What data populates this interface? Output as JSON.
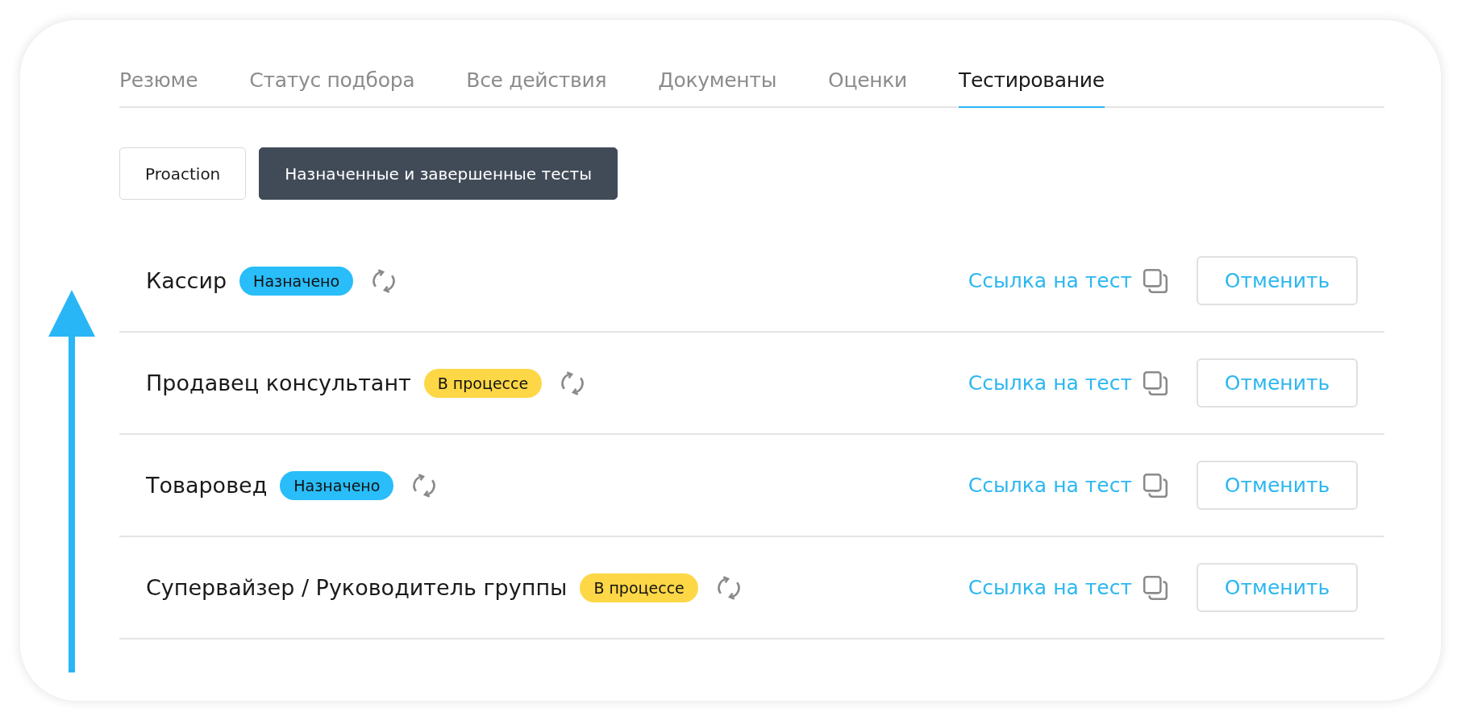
{
  "tabs": [
    {
      "label": "Резюме",
      "selected": false
    },
    {
      "label": "Статус подбора",
      "selected": false
    },
    {
      "label": "Все действия",
      "selected": false
    },
    {
      "label": "Документы",
      "selected": false
    },
    {
      "label": "Оценки",
      "selected": false
    },
    {
      "label": "Тестирование",
      "selected": true
    }
  ],
  "subtabs": [
    {
      "label": "Proaction",
      "selected": false
    },
    {
      "label": "Назначенные и завершенные тесты",
      "selected": true
    }
  ],
  "tests": [
    {
      "name": "Кассир",
      "status": {
        "label": "Назначено",
        "kind": "assigned"
      },
      "link": "Ссылка на тест",
      "cancel": "Отменить"
    },
    {
      "name": "Продавец консультант",
      "status": {
        "label": "В процессе",
        "kind": "in_progress"
      },
      "link": "Ссылка на тест",
      "cancel": "Отменить"
    },
    {
      "name": "Товаровед",
      "status": {
        "label": "Назначено",
        "kind": "assigned"
      },
      "link": "Ссылка на тест",
      "cancel": "Отменить"
    },
    {
      "name": "Супервайзер / Руководитель группы",
      "status": {
        "label": "В процессе",
        "kind": "in_progress"
      },
      "link": "Ссылка на тест",
      "cancel": "Отменить"
    }
  ]
}
